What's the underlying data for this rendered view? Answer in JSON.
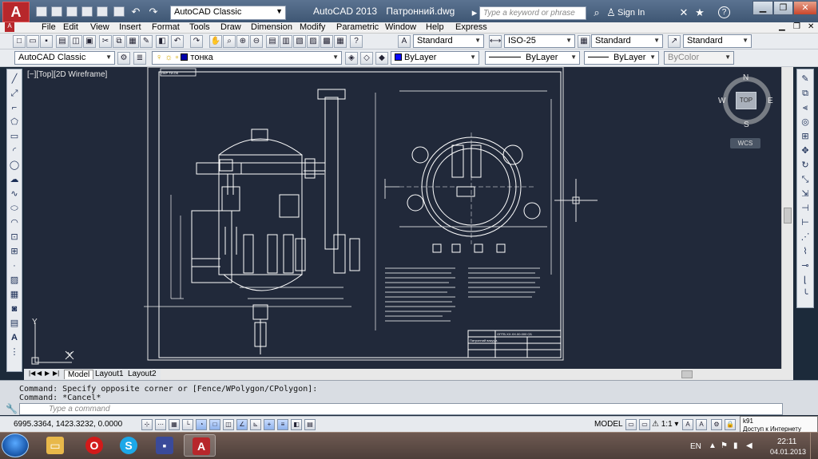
{
  "titlebar": {
    "workspace_combo": "AutoCAD Classic",
    "app_name": "AutoCAD 2013",
    "file_name": "Патронний.dwg",
    "search_placeholder": "Type a keyword or phrase",
    "sign_in": "Sign In",
    "help": "?"
  },
  "menu": [
    "File",
    "Edit",
    "View",
    "Insert",
    "Format",
    "Tools",
    "Draw",
    "Dimension",
    "Modify",
    "Parametric",
    "Window",
    "Help",
    "Express"
  ],
  "styles_toolbar": {
    "text_style": "Standard",
    "dim_style": "ISO-25",
    "table_style": "Standard",
    "multileader_style": "Standard"
  },
  "layers_toolbar": {
    "workspace": "AutoCAD Classic",
    "current_layer": "тонка",
    "color": "ByLayer",
    "linetype": "ByLayer",
    "lineweight": "ByLayer",
    "plot_style": "ByColor"
  },
  "viewport": {
    "label": "[−][Top][2D Wireframe]",
    "viewcube": {
      "n": "N",
      "s": "S",
      "e": "E",
      "w": "W",
      "top": "TOP",
      "wcs": "WCS"
    }
  },
  "drawing": {
    "stamp_label": "ОКР ТИ.ОК",
    "title_block_code": "ОПТБ.ХХ.ХХ.00.000 СБ",
    "title_block_name": "Патронний вакуум-",
    "ucs_x": "X",
    "ucs_y": "Y"
  },
  "layout_tabs": [
    "Model",
    "Layout1",
    "Layout2"
  ],
  "command": {
    "history": [
      "Command: Specify opposite corner or [Fence/WPolygon/CPolygon]:",
      "Command: *Cancel*"
    ],
    "placeholder": "Type a command"
  },
  "statusbar": {
    "coords": "6995.3364, 1423.3232, 0.0000",
    "model": "MODEL",
    "scale": "1:1",
    "tooltip": "k91\nДоступ к Интернету"
  },
  "taskbar": {
    "lang": "EN",
    "time": "22:11",
    "date": "04.01.2013"
  }
}
